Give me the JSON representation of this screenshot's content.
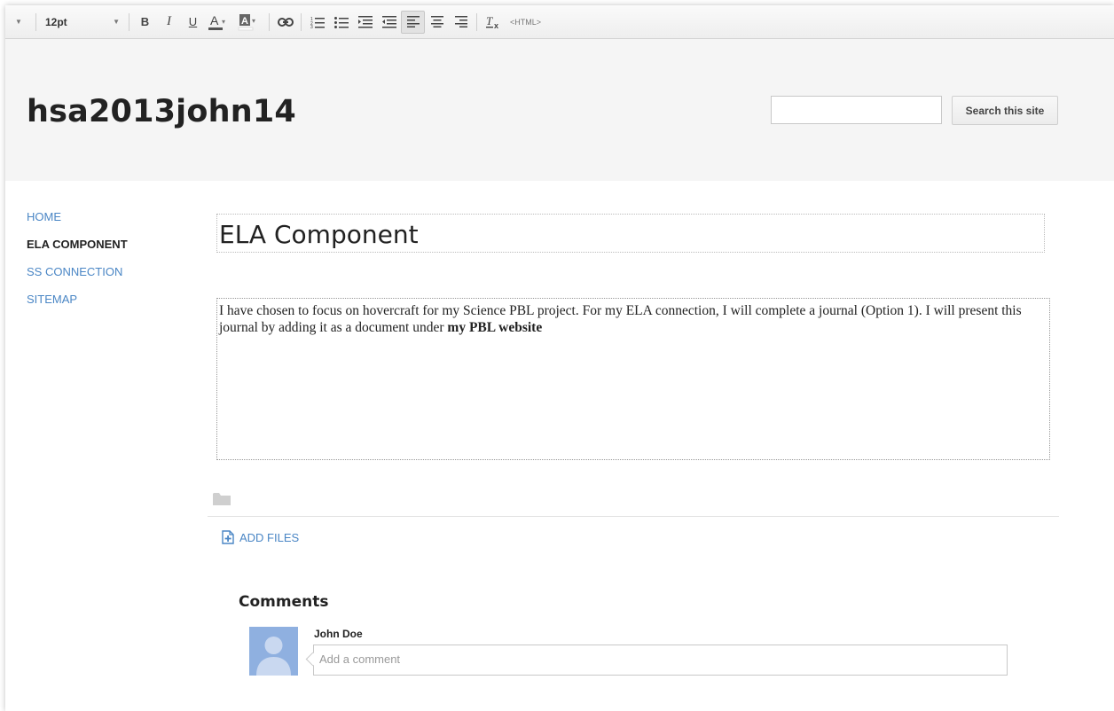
{
  "toolbar": {
    "font_size": "12pt",
    "html_label": "<HTML>"
  },
  "header": {
    "site_title": "hsa2013john14",
    "search_placeholder": "",
    "search_button": "Search this site"
  },
  "sidebar": {
    "items": [
      {
        "label": "HOME",
        "current": false
      },
      {
        "label": "ELA COMPONENT",
        "current": true
      },
      {
        "label": "SS CONNECTION",
        "current": false
      },
      {
        "label": "SITEMAP",
        "current": false
      }
    ]
  },
  "main": {
    "page_title": "ELA Component",
    "body_text": "I have chosen to focus on hovercraft for my Science PBL project. For my ELA connection, I will complete a journal (Option 1). I will present this journal by adding it as a document under ",
    "body_bold": "my PBL website",
    "add_files": "ADD FILES"
  },
  "comments": {
    "title": "Comments",
    "author": "John Doe",
    "placeholder": "Add a comment"
  },
  "colors": {
    "link": "#4a86c5",
    "header_bg": "#f5f5f5",
    "avatar_bg": "#8fb0e0"
  }
}
